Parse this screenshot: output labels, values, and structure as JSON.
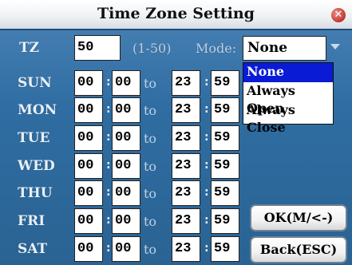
{
  "window": {
    "title": "Time Zone Setting"
  },
  "tz": {
    "label": "TZ",
    "value": "50",
    "range": "(1-50)"
  },
  "mode": {
    "label": "Mode:",
    "selected": "None",
    "options": [
      "None",
      "Always Open",
      "Always Close"
    ]
  },
  "to_label": "to",
  "days": [
    {
      "label": "SUN",
      "start_h": "00",
      "start_m": "00",
      "end_h": "23",
      "end_m": "59"
    },
    {
      "label": "MON",
      "start_h": "00",
      "start_m": "00",
      "end_h": "23",
      "end_m": "59"
    },
    {
      "label": "TUE",
      "start_h": "00",
      "start_m": "00",
      "end_h": "23",
      "end_m": "59"
    },
    {
      "label": "WED",
      "start_h": "00",
      "start_m": "00",
      "end_h": "23",
      "end_m": "59"
    },
    {
      "label": "THU",
      "start_h": "00",
      "start_m": "00",
      "end_h": "23",
      "end_m": "59"
    },
    {
      "label": "FRI",
      "start_h": "00",
      "start_m": "00",
      "end_h": "23",
      "end_m": "59"
    },
    {
      "label": "SAT",
      "start_h": "00",
      "start_m": "00",
      "end_h": "23",
      "end_m": "59"
    }
  ],
  "buttons": {
    "ok": "OK(M/<-)",
    "back": "Back(ESC)"
  },
  "colors": {
    "selected_option_bg": "#0a1bd6",
    "close_icon": "#c0392b"
  }
}
